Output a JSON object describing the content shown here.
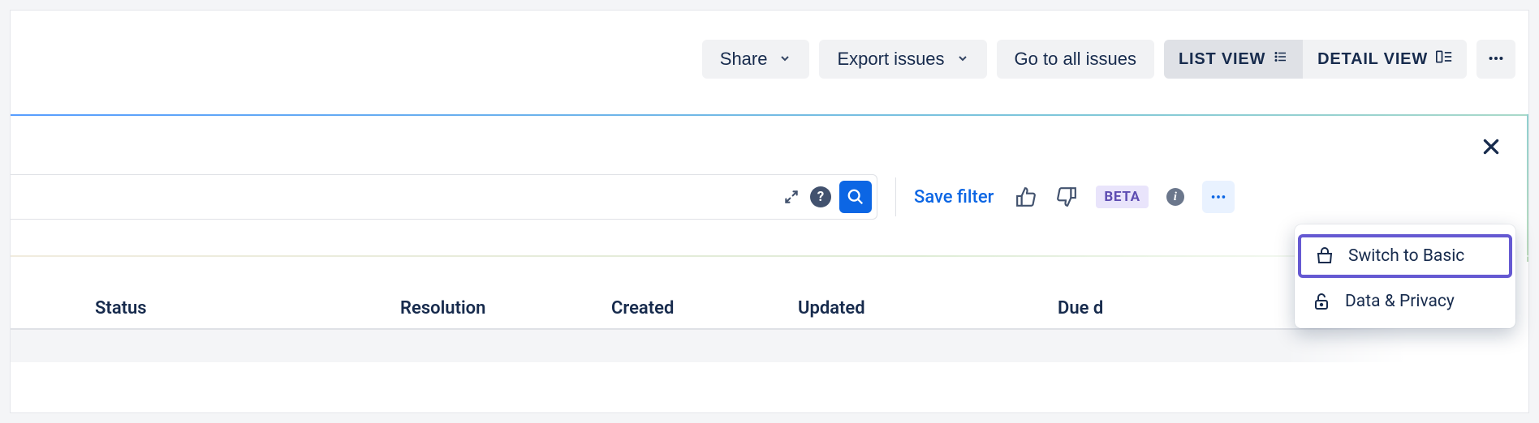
{
  "toolbar": {
    "share_label": "Share",
    "export_label": "Export issues",
    "goto_label": "Go to all issues",
    "list_view_label": "LIST VIEW",
    "detail_view_label": "DETAIL VIEW"
  },
  "search": {
    "placeholder": "",
    "value": "",
    "save_filter_label": "Save filter",
    "beta_label": "BETA"
  },
  "dropdown": {
    "items": [
      {
        "label": "Switch to Basic",
        "icon": "basket-icon",
        "highlighted": true
      },
      {
        "label": "Data & Privacy",
        "icon": "lock-icon",
        "highlighted": false
      }
    ]
  },
  "columns": [
    "Status",
    "Resolution",
    "Created",
    "Updated",
    "Due d"
  ]
}
